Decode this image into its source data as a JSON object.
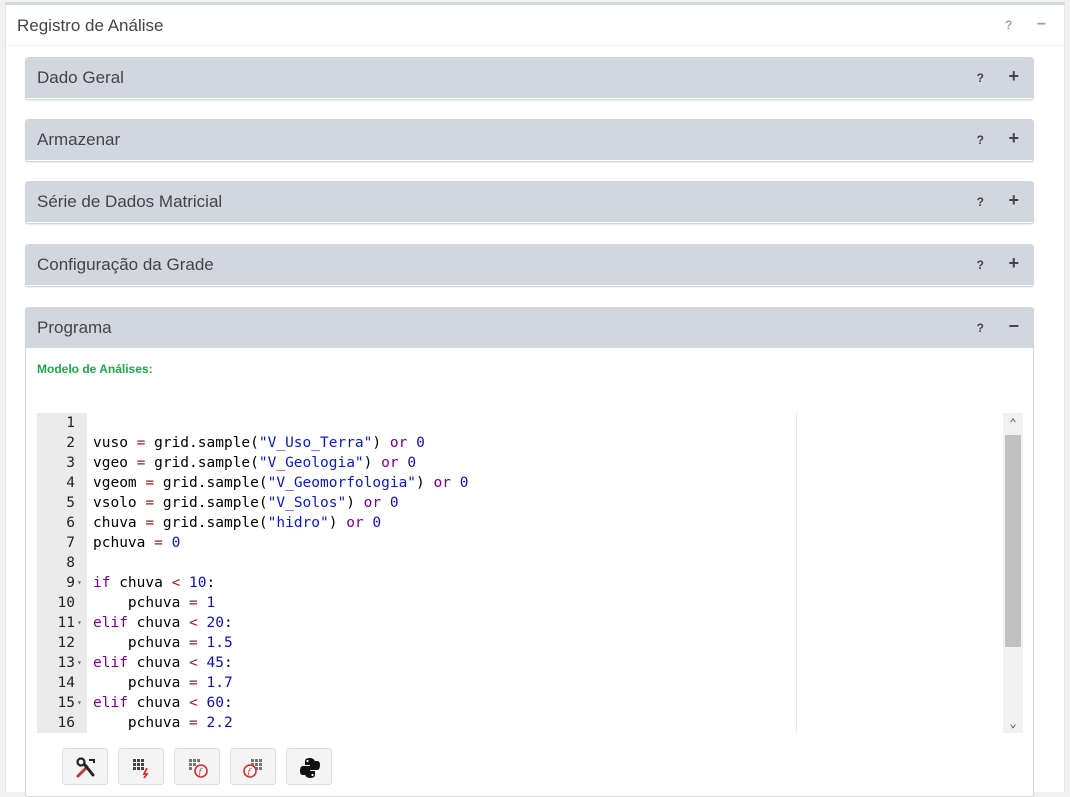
{
  "panel": {
    "title": "Registro de Análise",
    "help_label": "?",
    "collapse_label": "−"
  },
  "sections": [
    {
      "title": "Dado Geral",
      "help": "?",
      "toggle": "+"
    },
    {
      "title": "Armazenar",
      "help": "?",
      "toggle": "+"
    },
    {
      "title": "Série de Dados Matricial",
      "help": "?",
      "toggle": "+"
    },
    {
      "title": "Configuração da Grade",
      "help": "?",
      "toggle": "+"
    },
    {
      "title": "Programa",
      "help": "?",
      "toggle": "−"
    }
  ],
  "programa": {
    "model_label": "Modelo de Análises:",
    "line_numbers": [
      "1",
      "2",
      "3",
      "4",
      "5",
      "6",
      "7",
      "8",
      "9",
      "10",
      "11",
      "12",
      "13",
      "14",
      "15",
      "16"
    ],
    "fold_markers": [
      "",
      "",
      "",
      "",
      "",
      "",
      "",
      "",
      "▾",
      "",
      "▾",
      "",
      "▾",
      "",
      "▾",
      ""
    ],
    "code_lines": [
      "",
      "vuso = grid.sample(\"V_Uso_Terra\") or 0",
      "vgeo = grid.sample(\"V_Geologia\") or 0",
      "vgeom = grid.sample(\"V_Geomorfologia\") or 0",
      "vsolo = grid.sample(\"V_Solos\") or 0",
      "chuva = grid.sample(\"hidro\") or 0",
      "pchuva = 0",
      "",
      "if chuva < 10:",
      "    pchuva = 1",
      "elif chuva < 20:",
      "    pchuva = 1.5",
      "elif chuva < 45:",
      "    pchuva = 1.7",
      "elif chuva < 60:",
      "    pchuva = 2.2"
    ],
    "toolbar_buttons": [
      "tools-icon",
      "grid-function-icon",
      "grid-history-function-icon",
      "grid-cube-function-icon",
      "python-icon"
    ]
  },
  "colors": {
    "header_bg": "#d2d6de",
    "model_label": "#1ea54a",
    "keyword": "#770088",
    "string": "#0a1bbd",
    "number": "#1010aa"
  }
}
